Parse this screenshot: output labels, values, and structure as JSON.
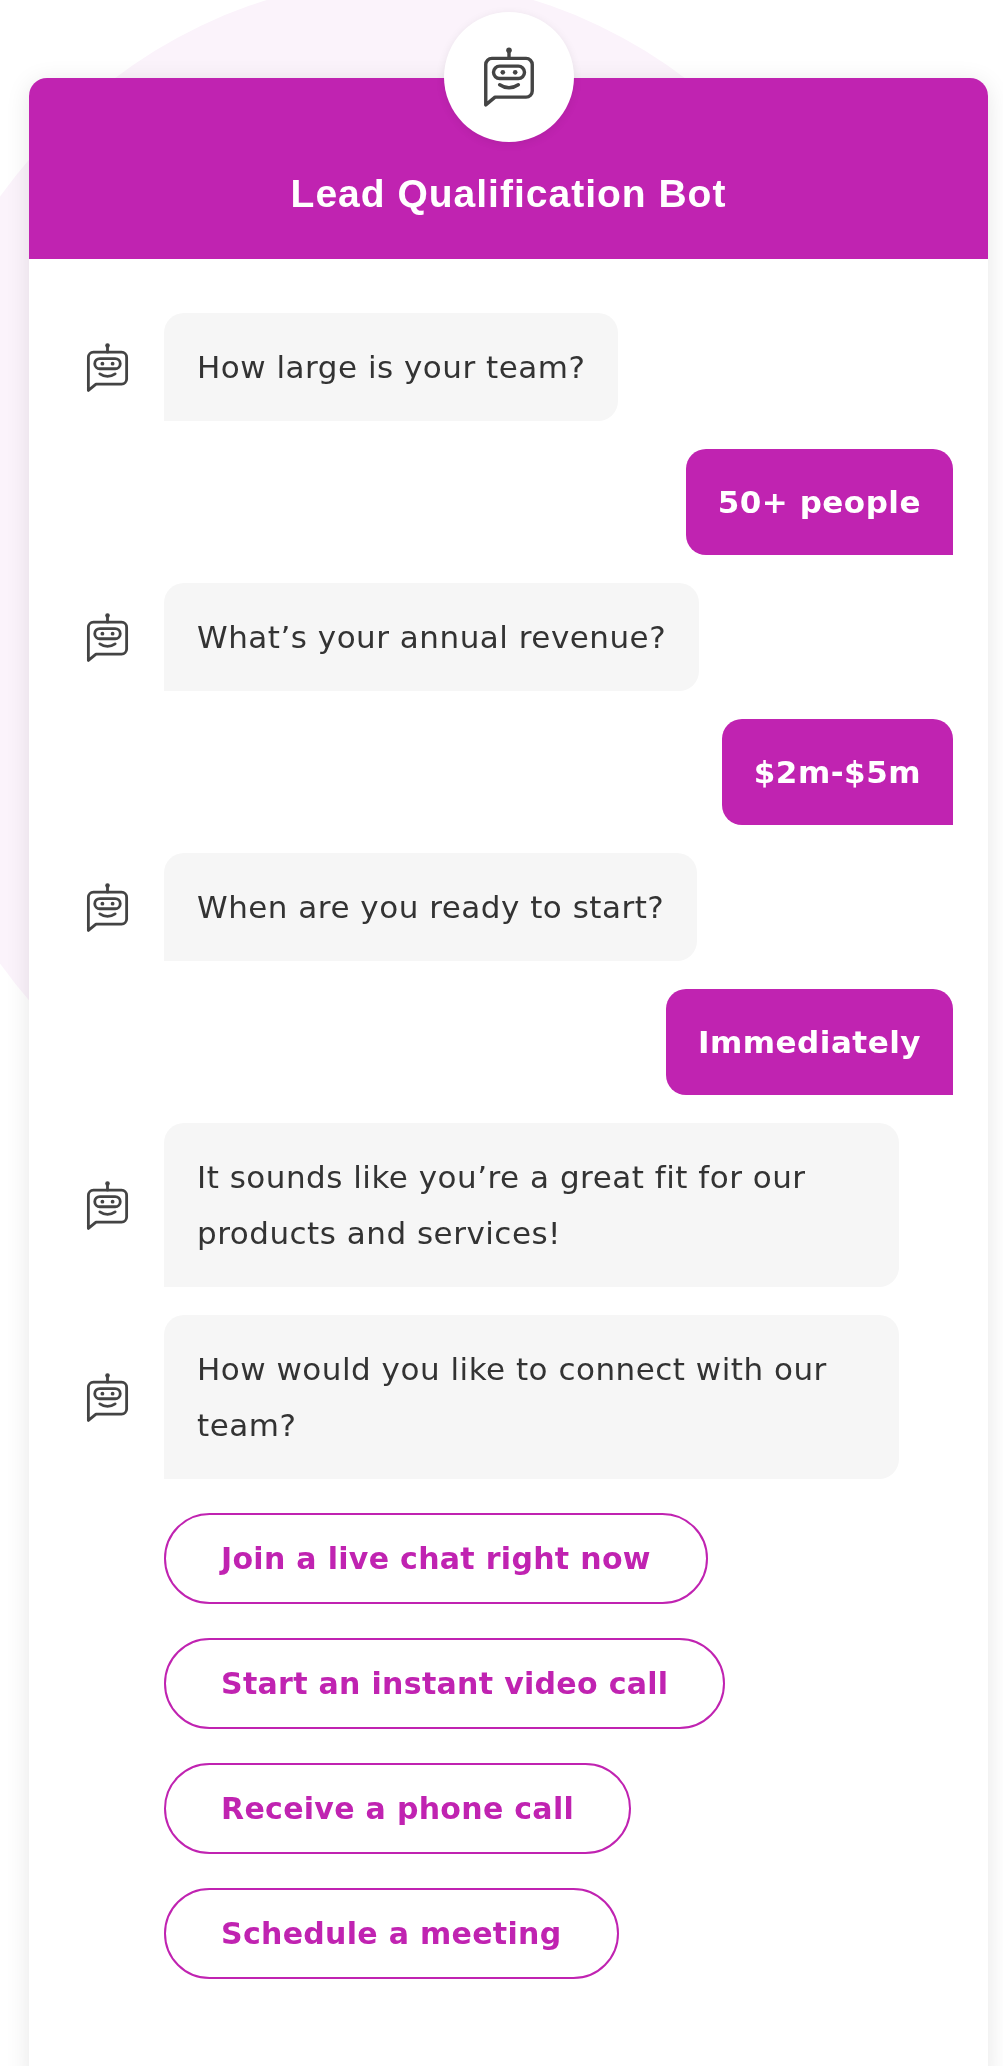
{
  "header": {
    "title": "Lead Qualification Bot"
  },
  "messages": [
    {
      "kind": "bot",
      "text": "How large is your team?"
    },
    {
      "kind": "user",
      "text": "50+ people"
    },
    {
      "kind": "bot",
      "text": "What’s your annual revenue?"
    },
    {
      "kind": "user",
      "text": "$2m-$5m"
    },
    {
      "kind": "bot",
      "text": "When are you ready to start?"
    },
    {
      "kind": "user",
      "text": "Immediately"
    },
    {
      "kind": "bot",
      "text": "It sounds like you’re a great fit for our products and services!"
    },
    {
      "kind": "bot",
      "text": "How would you like to connect with our team?"
    }
  ],
  "options": [
    "Join a live chat right now",
    "Start an instant video call",
    "Receive a phone call",
    "Schedule a meeting"
  ]
}
